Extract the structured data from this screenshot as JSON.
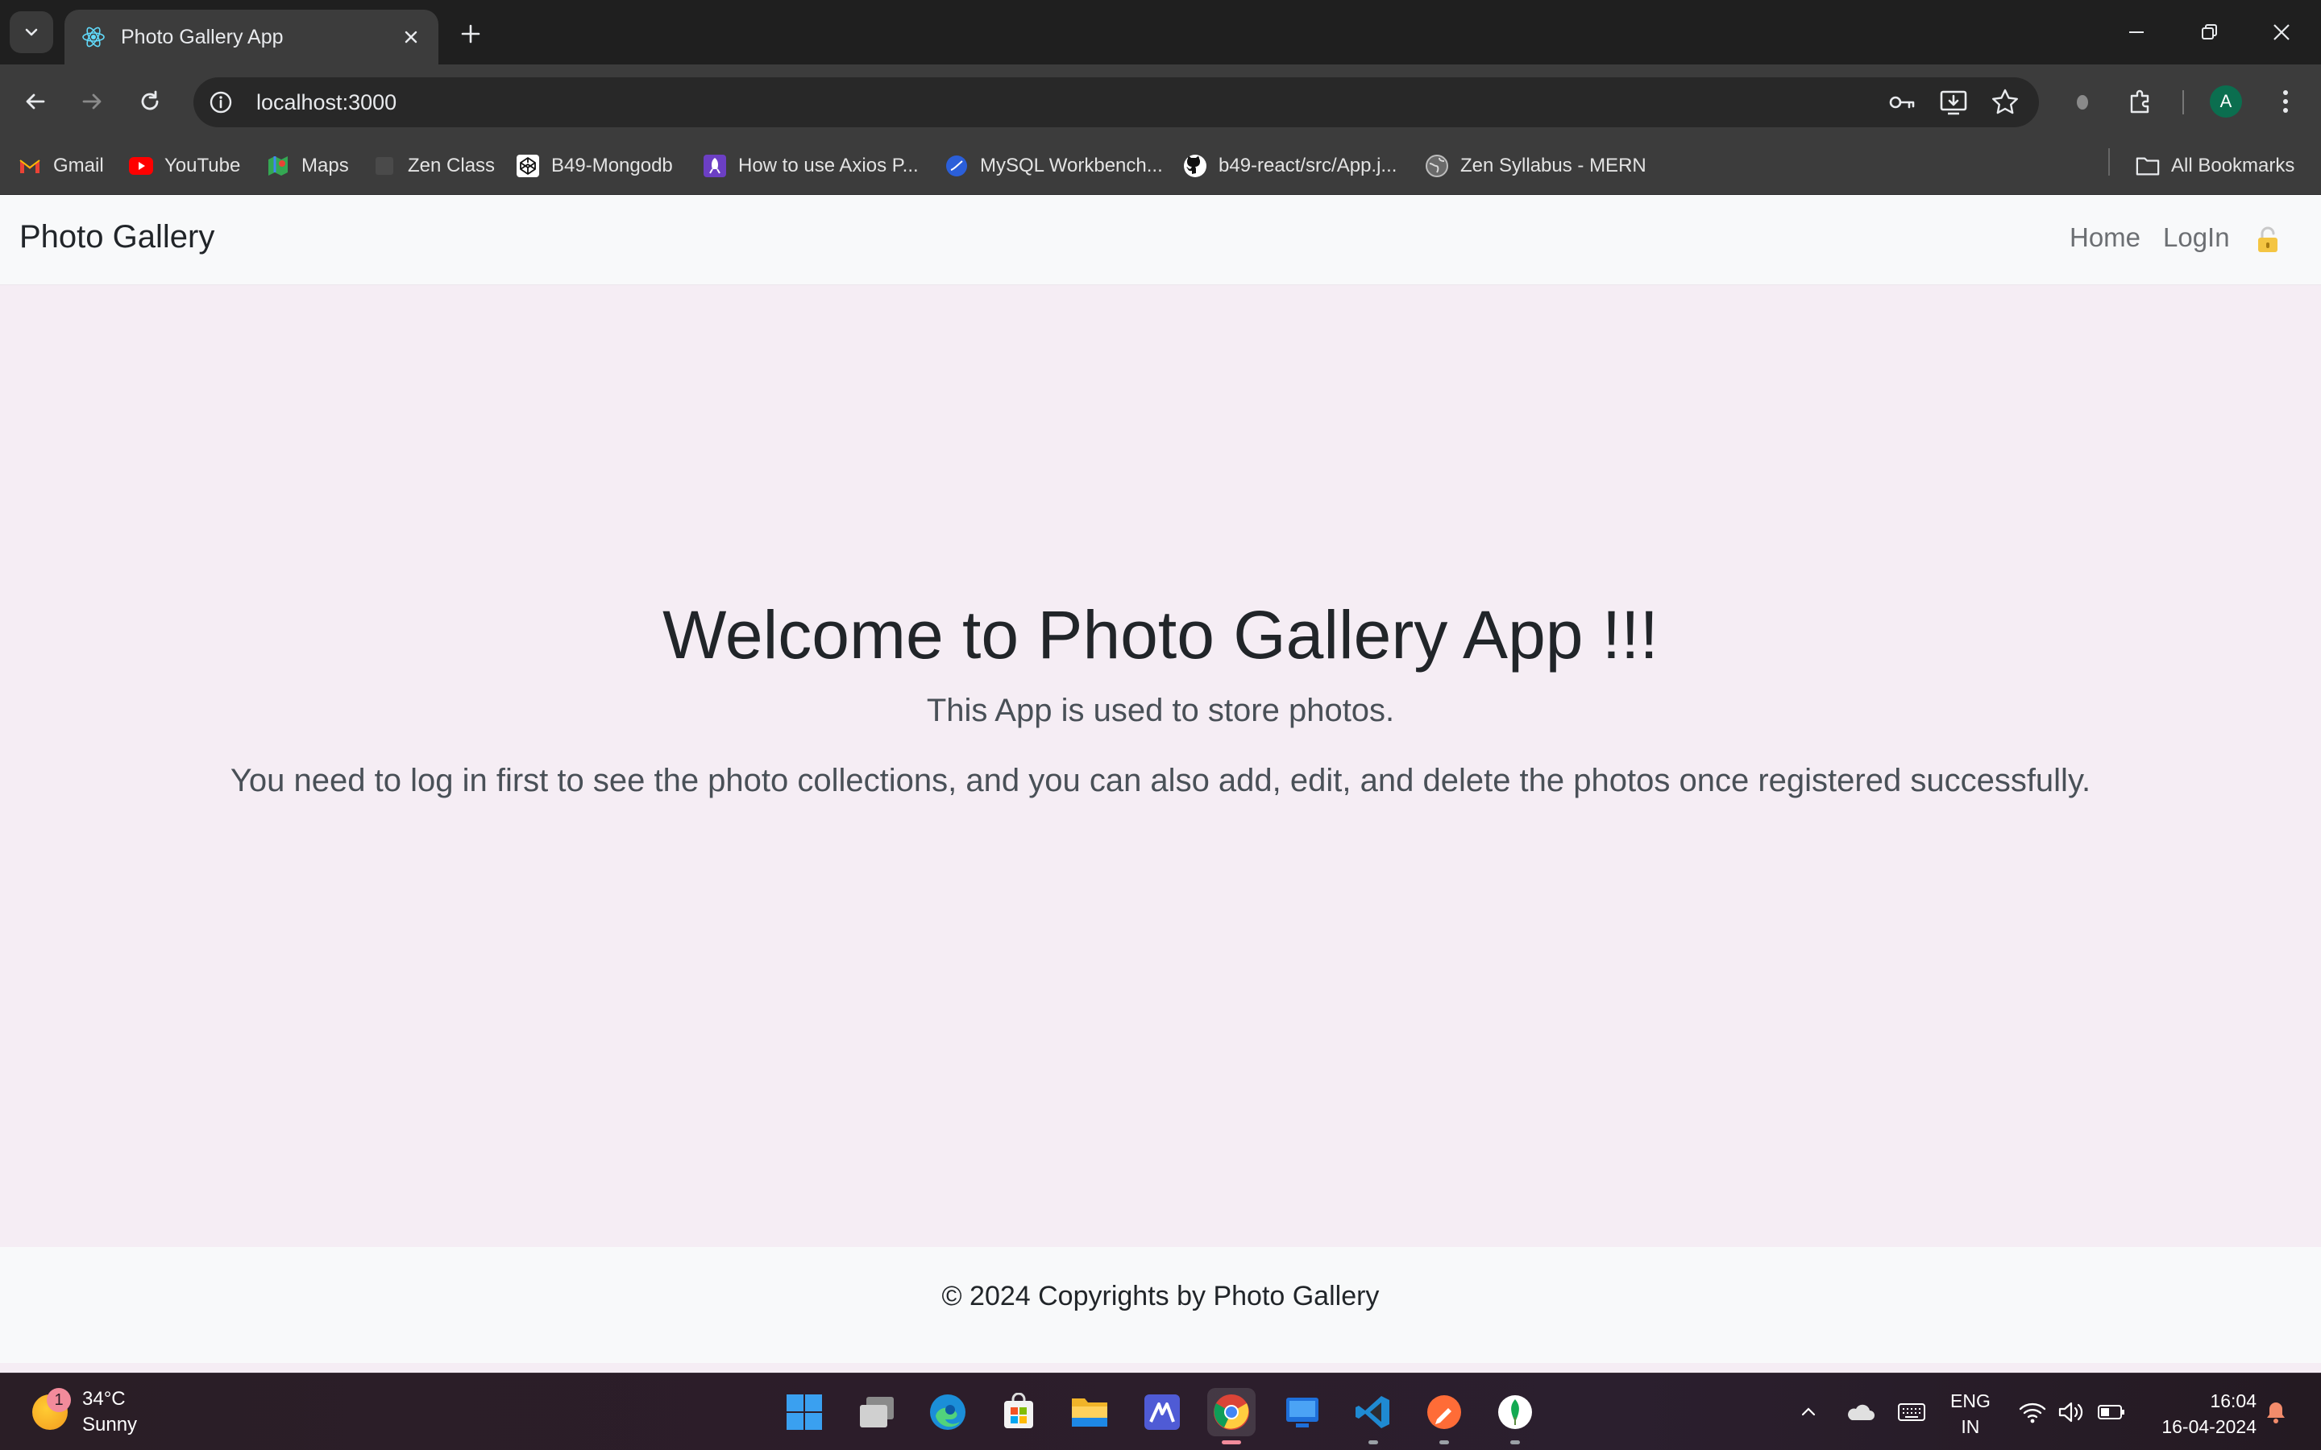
{
  "browser": {
    "tab_title": "Photo Gallery App",
    "url": "localhost:3000",
    "profile_initial": "A",
    "bookmarks": [
      {
        "label": "Gmail",
        "icon": "gmail-icon"
      },
      {
        "label": "YouTube",
        "icon": "youtube-icon"
      },
      {
        "label": "Maps",
        "icon": "maps-icon"
      },
      {
        "label": "Zen Class",
        "icon": "zen-class-icon"
      },
      {
        "label": "B49-Mongodb",
        "icon": "codepen-icon"
      },
      {
        "label": "How to use Axios P...",
        "icon": "rocket-icon"
      },
      {
        "label": "MySQL Workbench...",
        "icon": "mysql-icon"
      },
      {
        "label": "b49-react/src/App.j...",
        "icon": "github-icon"
      },
      {
        "label": "Zen Syllabus - MERN",
        "icon": "globe-icon"
      }
    ],
    "all_bookmarks_label": "All Bookmarks"
  },
  "app": {
    "brand": "Photo Gallery",
    "nav": {
      "home": "Home",
      "login": "LogIn"
    },
    "hero": {
      "title": "Welcome to Photo Gallery App !!!",
      "subtitle": "This App is used to store photos.",
      "description": "You need to log in first to see the photo collections, and you can also add, edit, and delete the photos once registered successfully."
    },
    "footer": "© 2024 Copyrights by Photo Gallery"
  },
  "taskbar": {
    "weather": {
      "temp": "34°C",
      "condition": "Sunny",
      "badge": "1"
    },
    "language": {
      "line1": "ENG",
      "line2": "IN"
    },
    "clock": {
      "time": "16:04",
      "date": "16-04-2024"
    }
  },
  "colors": {
    "page_bg": "#f5edf4",
    "navbar_bg": "#f8f9fa",
    "browser_dark": "#3c3c3c"
  }
}
